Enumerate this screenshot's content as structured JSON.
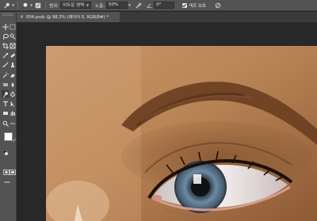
{
  "options_bar": {
    "width_label": "범위:",
    "range_value": "어두운 영역",
    "exposure_label": "노출:",
    "exposure_value": "50%",
    "angle_value": "0°",
    "protect_tone_label": "색조 보호"
  },
  "document_tab": {
    "title": "004.psdc @ 98.3% (레이어 0, RGB/8#) *"
  },
  "colors": {
    "panel": "#535353",
    "canvas_bg": "#282828",
    "foreground": "#ffffff",
    "background": "#ffffff"
  },
  "tools": [
    "move-tool",
    "marquee-tool",
    "lasso-tool",
    "quick-select-tool",
    "crop-tool",
    "frame-tool",
    "eyedropper-tool",
    "spot-heal-tool",
    "brush-tool",
    "stamp-tool",
    "history-brush-tool",
    "eraser-tool",
    "gradient-tool",
    "blur-tool",
    "dodge-tool",
    "pen-tool",
    "type-tool",
    "path-select-tool",
    "rectangle-tool",
    "hand-tool",
    "zoom-tool",
    "more-tools"
  ]
}
